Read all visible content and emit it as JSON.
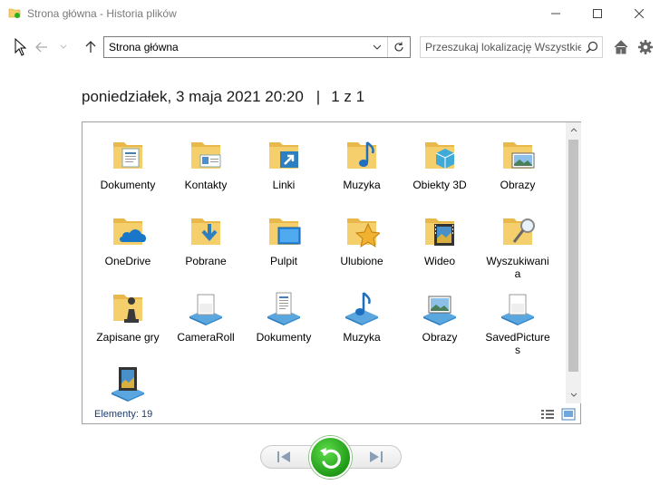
{
  "window": {
    "title": "Strona główna - Historia plików",
    "icon": "file-history-folder-icon"
  },
  "nav": {
    "address": "Strona główna",
    "search_placeholder": "Przeszukaj lokalizację Wszystkie"
  },
  "header": {
    "date": "poniedziałek, 3 maja 2021 20:20",
    "separator": "|",
    "page_of": "1 z 1"
  },
  "items": [
    {
      "label": "Dokumenty",
      "icon": "documents-folder-icon"
    },
    {
      "label": "Kontakty",
      "icon": "contacts-folder-icon"
    },
    {
      "label": "Linki",
      "icon": "links-folder-icon"
    },
    {
      "label": "Muzyka",
      "icon": "music-folder-icon"
    },
    {
      "label": "Obiekty 3D",
      "icon": "3d-objects-folder-icon"
    },
    {
      "label": "Obrazy",
      "icon": "pictures-folder-icon"
    },
    {
      "label": "OneDrive",
      "icon": "onedrive-folder-icon"
    },
    {
      "label": "Pobrane",
      "icon": "downloads-folder-icon"
    },
    {
      "label": "Pulpit",
      "icon": "desktop-folder-icon"
    },
    {
      "label": "Ulubione",
      "icon": "favorites-folder-icon"
    },
    {
      "label": "Wideo",
      "icon": "videos-folder-icon"
    },
    {
      "label": "Wyszukiwania",
      "icon": "searches-folder-icon"
    },
    {
      "label": "Zapisane gry",
      "icon": "saved-games-folder-icon"
    },
    {
      "label": "CameraRoll",
      "icon": "camera-roll-library-icon"
    },
    {
      "label": "Dokumenty",
      "icon": "documents-library-icon"
    },
    {
      "label": "Muzyka",
      "icon": "music-library-icon"
    },
    {
      "label": "Obrazy",
      "icon": "pictures-library-icon"
    },
    {
      "label": "SavedPictures",
      "icon": "saved-pictures-library-icon"
    },
    {
      "label": "",
      "icon": "videos-library-icon"
    }
  ],
  "status": {
    "count_text": "Elementy: 19"
  },
  "colors": {
    "folder": "#f4cf6b",
    "restore_green": "#2bb11f",
    "status_text": "#1f3a6b"
  }
}
